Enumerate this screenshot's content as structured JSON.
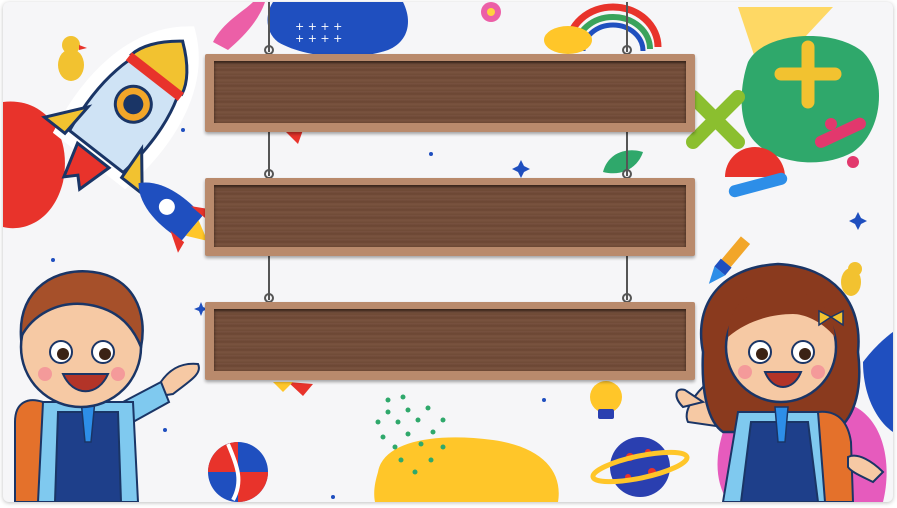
{
  "scene": {
    "background": "#f6f6f8",
    "board_color": "#b98a6c",
    "board_inner_color": "#74503c",
    "boards": [
      {
        "label": ""
      },
      {
        "label": ""
      },
      {
        "label": ""
      }
    ],
    "icons": [
      "rocket-sticker-icon",
      "small-rocket-icon",
      "boy-student-icon",
      "girl-student-icon",
      "math-symbols-icon",
      "rainbow-icon",
      "lightbulb-icon",
      "planet-icon",
      "beach-ball-icon",
      "paint-brush-icon",
      "flower-icon",
      "duck-icon",
      "leaf-icon",
      "sparkle-icon"
    ]
  }
}
